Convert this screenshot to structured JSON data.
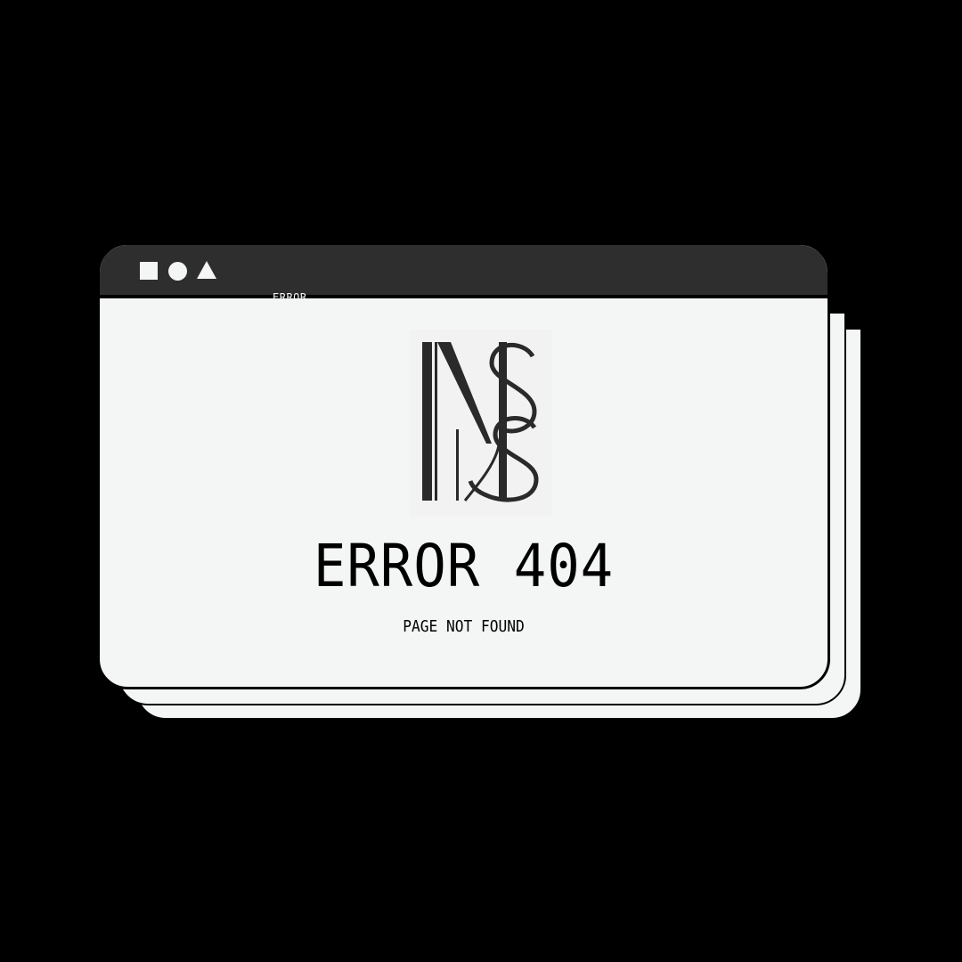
{
  "window": {
    "tab_label": "ERROR",
    "controls": [
      "square-icon",
      "circle-icon",
      "triangle-icon"
    ]
  },
  "logo": {
    "text": "NS",
    "name": "ns-monogram-logo"
  },
  "error": {
    "title": "ERROR 404",
    "subtitle": "PAGE NOT FOUND"
  },
  "colors": {
    "background": "#000000",
    "titlebar": "#2e2e2e",
    "window": "#f4f6f5",
    "text": "#000000",
    "logo_ink": "#2a2a2a"
  }
}
